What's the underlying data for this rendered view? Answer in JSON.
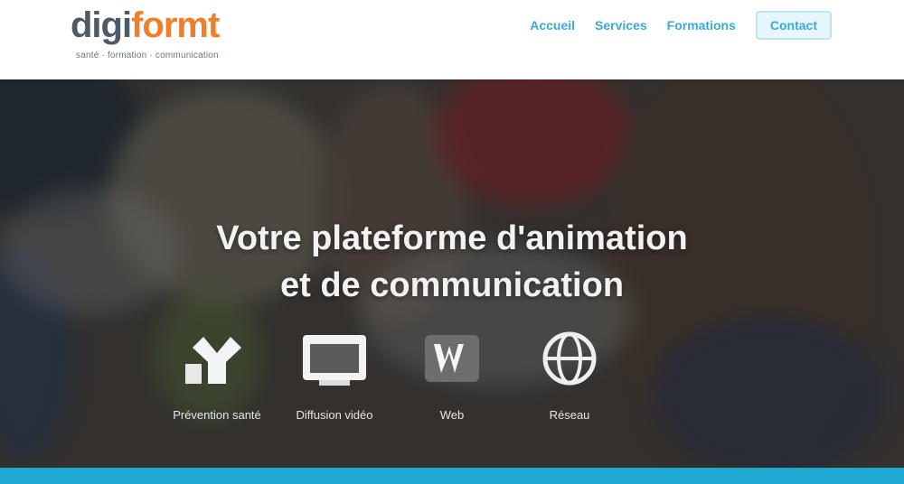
{
  "header": {
    "logo": {
      "part1": "digi",
      "part2": "formt",
      "tagline": "santé · formation · communication"
    },
    "nav": [
      {
        "label": "Accueil"
      },
      {
        "label": "Services"
      },
      {
        "label": "Formations"
      }
    ],
    "cta_label": "Contact"
  },
  "hero": {
    "title_line1": "Votre plateforme d'animation",
    "title_line2": "et de communication",
    "icons": [
      {
        "icon": "arms-icon",
        "label": "Prévention santé"
      },
      {
        "icon": "video-icon",
        "label": "Diffusion vidéo"
      },
      {
        "icon": "w-icon",
        "label": "Web"
      },
      {
        "icon": "globe-icon",
        "label": "Réseau"
      }
    ]
  },
  "colors": {
    "brand_orange": "#f07f2c",
    "brand_gray": "#4d5b66",
    "nav_blue": "#3aa9d8",
    "accent_bar": "#20a9d3"
  }
}
